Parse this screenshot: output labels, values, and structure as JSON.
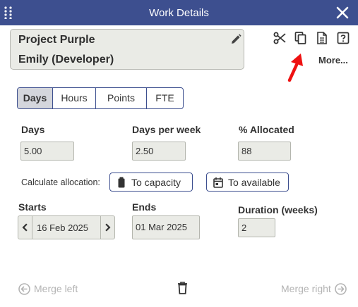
{
  "window": {
    "title": "Work Details"
  },
  "card": {
    "project": "Project Purple",
    "person": "Emily (Developer)"
  },
  "toolbar": {
    "more_label": "More..."
  },
  "tabs": [
    {
      "label": "Days",
      "active": true
    },
    {
      "label": "Hours",
      "active": false
    },
    {
      "label": "Points",
      "active": false
    },
    {
      "label": "FTE",
      "active": false
    }
  ],
  "fields": {
    "days": {
      "label": "Days",
      "value": "5.00"
    },
    "days_per_week": {
      "label": "Days per week",
      "value": "2.50"
    },
    "allocated": {
      "label": "% Allocated",
      "value": "88"
    },
    "starts": {
      "label": "Starts",
      "value": "16 Feb 2025"
    },
    "ends": {
      "label": "Ends",
      "value": "01 Mar 2025"
    },
    "duration": {
      "label": "Duration (weeks)",
      "value": "2"
    }
  },
  "calc": {
    "label": "Calculate allocation:",
    "to_capacity": "To capacity",
    "to_available": "To available"
  },
  "footer": {
    "merge_left": "Merge left",
    "merge_right": "Merge right"
  },
  "colors": {
    "titlebar": "#3d4f8f",
    "accent_arrow": "#ee1111",
    "field_bg": "#eaebe6"
  }
}
